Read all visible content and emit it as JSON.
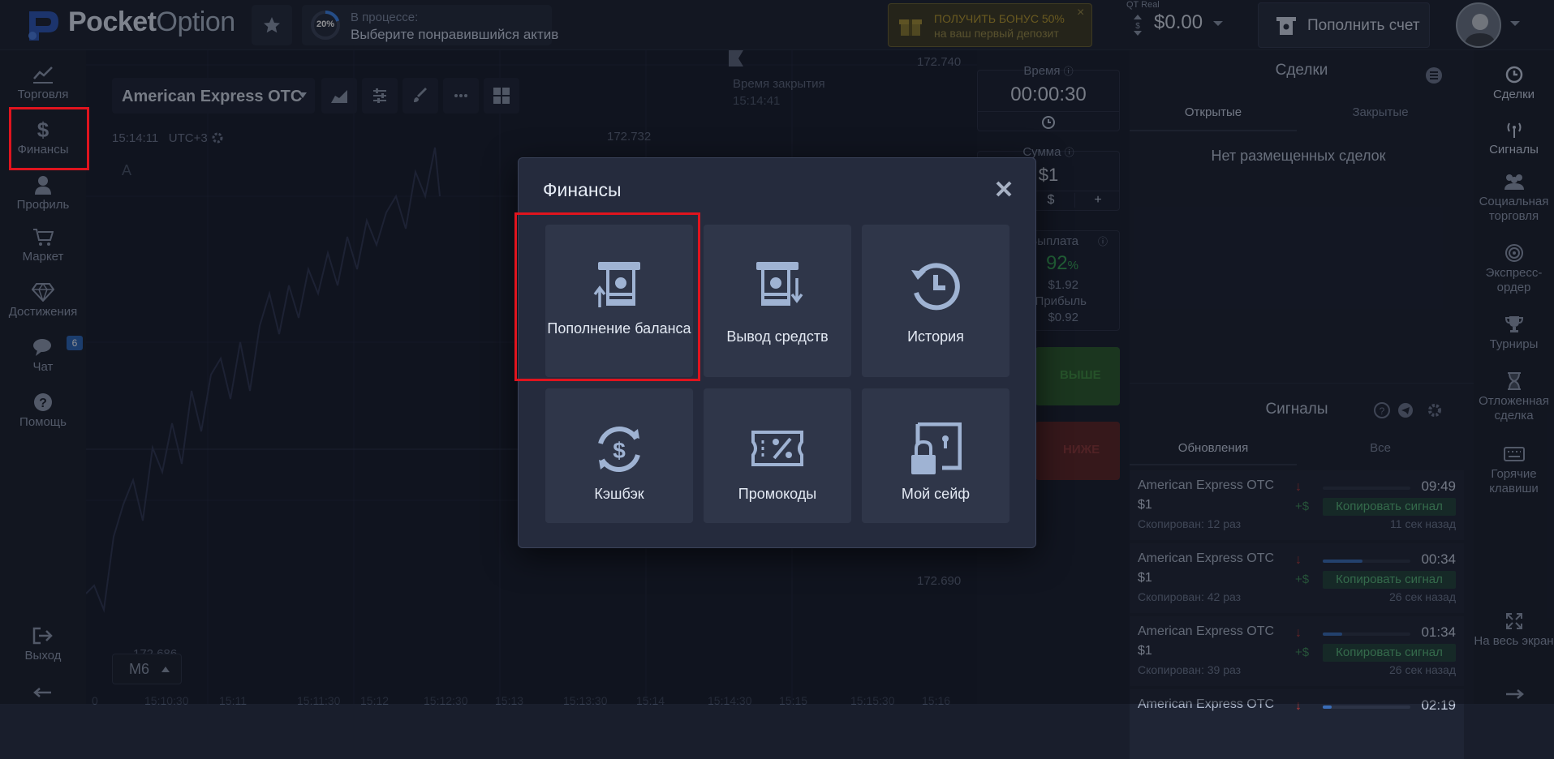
{
  "app": {
    "logo_bold": "Pocket",
    "logo_light": "Option"
  },
  "topbar": {
    "progress_percent": "20%",
    "progress_title": "В процессе:",
    "progress_text": "Выберите понравившийся актив",
    "bonus_line1": "ПОЛУЧИТЬ БОНУС 50%",
    "bonus_line2": "на ваш первый депозит",
    "bonus_close": "×",
    "account_type": "QT Real",
    "balance": "$0.00",
    "deposit_label": "Пополнить счет"
  },
  "left_nav": [
    {
      "label": "Торговля",
      "icon": "chart-line-icon"
    },
    {
      "label": "Финансы",
      "icon": "dollar-icon"
    },
    {
      "label": "Профиль",
      "icon": "user-icon"
    },
    {
      "label": "Маркет",
      "icon": "cart-icon"
    },
    {
      "label": "Достижения",
      "icon": "diamond-icon"
    },
    {
      "label": "Чат",
      "icon": "chat-icon"
    },
    {
      "label": "Помощь",
      "icon": "help-icon"
    }
  ],
  "chat_badge": "6",
  "logout_label": "Выход",
  "chart": {
    "asset": "American Express OTC",
    "clock": "15:14:11",
    "timezone": "UTC+3",
    "close_time_label": "Время закрытия",
    "close_time_value": "15:14:41",
    "price_top": "172.740",
    "price_mid": "172.732",
    "price_low": "172.690",
    "price_bottom": "172.686",
    "timeframe": "M6",
    "letter": "A",
    "x_ticks": [
      "0",
      "15:10:30",
      "15:11",
      "15:11:30",
      "15:12",
      "15:12:30",
      "15:13",
      "15:13:30",
      "15:14",
      "15:14:30",
      "15:15",
      "15:15:30",
      "15:16"
    ]
  },
  "trade_panel": {
    "time_label": "Время",
    "time_value": "00:00:30",
    "amount_label": "Сумма",
    "amount_value": "$1",
    "amount_currency": "$",
    "amount_plus": "+",
    "payout_label": "Выплата",
    "payout_percent": "92",
    "payout_percent_sign": "%",
    "payout_amount": "$1.92",
    "profit_label": "Прибыль",
    "profit_value": "$0.92",
    "up_label": "ВЫШЕ",
    "down_label": "НИЖЕ"
  },
  "deals": {
    "title": "Сделки",
    "tab_open": "Открытые",
    "tab_closed": "Закрытые",
    "empty_text": "Нет размещенных сделок"
  },
  "signals": {
    "title": "Сигналы",
    "tab_updates": "Обновления",
    "tab_all": "Все",
    "items": [
      {
        "asset": "American Express OTC",
        "amount": "$1",
        "time": "09:49",
        "copy": "Копировать сигнал",
        "plus": "+$",
        "copied": "Скопирован: 12 раз",
        "ago": "11 сек назад",
        "bar": 0.0
      },
      {
        "asset": "American Express OTC",
        "amount": "$1",
        "time": "00:34",
        "copy": "Копировать сигнал",
        "plus": "+$",
        "copied": "Скопирован: 42 раз",
        "ago": "26 сек назад",
        "bar": 0.45
      },
      {
        "asset": "American Express OTC",
        "amount": "$1",
        "time": "01:34",
        "copy": "Копировать сигнал",
        "plus": "+$",
        "copied": "Скопирован: 39 раз",
        "ago": "26 сек назад",
        "bar": 0.22
      },
      {
        "asset": "American Express OTC",
        "amount": "",
        "time": "02:19",
        "copy": "",
        "plus": "",
        "copied": "",
        "ago": "",
        "bar": 0.1
      }
    ]
  },
  "right_nav": [
    {
      "label": "Сделки",
      "icon": "history-icon"
    },
    {
      "label": "Сигналы",
      "icon": "signal-icon"
    },
    {
      "label": "Социальная торговля",
      "icon": "users-icon"
    },
    {
      "label": "Экспресс-ордер",
      "icon": "target-icon"
    },
    {
      "label": "Турниры",
      "icon": "trophy-icon"
    },
    {
      "label": "Отложенная сделка",
      "icon": "hourglass-icon"
    },
    {
      "label": "Горячие клавиши",
      "icon": "keyboard-icon"
    },
    {
      "label": "На весь экран",
      "icon": "fullscreen-icon"
    }
  ],
  "modal": {
    "title": "Финансы",
    "tiles": [
      {
        "label": "Пополнение баланса",
        "icon": "deposit-icon"
      },
      {
        "label": "Вывод средств",
        "icon": "withdraw-icon"
      },
      {
        "label": "История",
        "icon": "history-icon"
      },
      {
        "label": "Кэшбэк",
        "icon": "cashback-icon"
      },
      {
        "label": "Промокоды",
        "icon": "promo-icon"
      },
      {
        "label": "Мой сейф",
        "icon": "safe-icon"
      }
    ]
  },
  "colors": {
    "highlight": "#e0141e",
    "up": "#2a5a2b",
    "down": "#5c2424",
    "accent_blue": "#2a66b8"
  }
}
